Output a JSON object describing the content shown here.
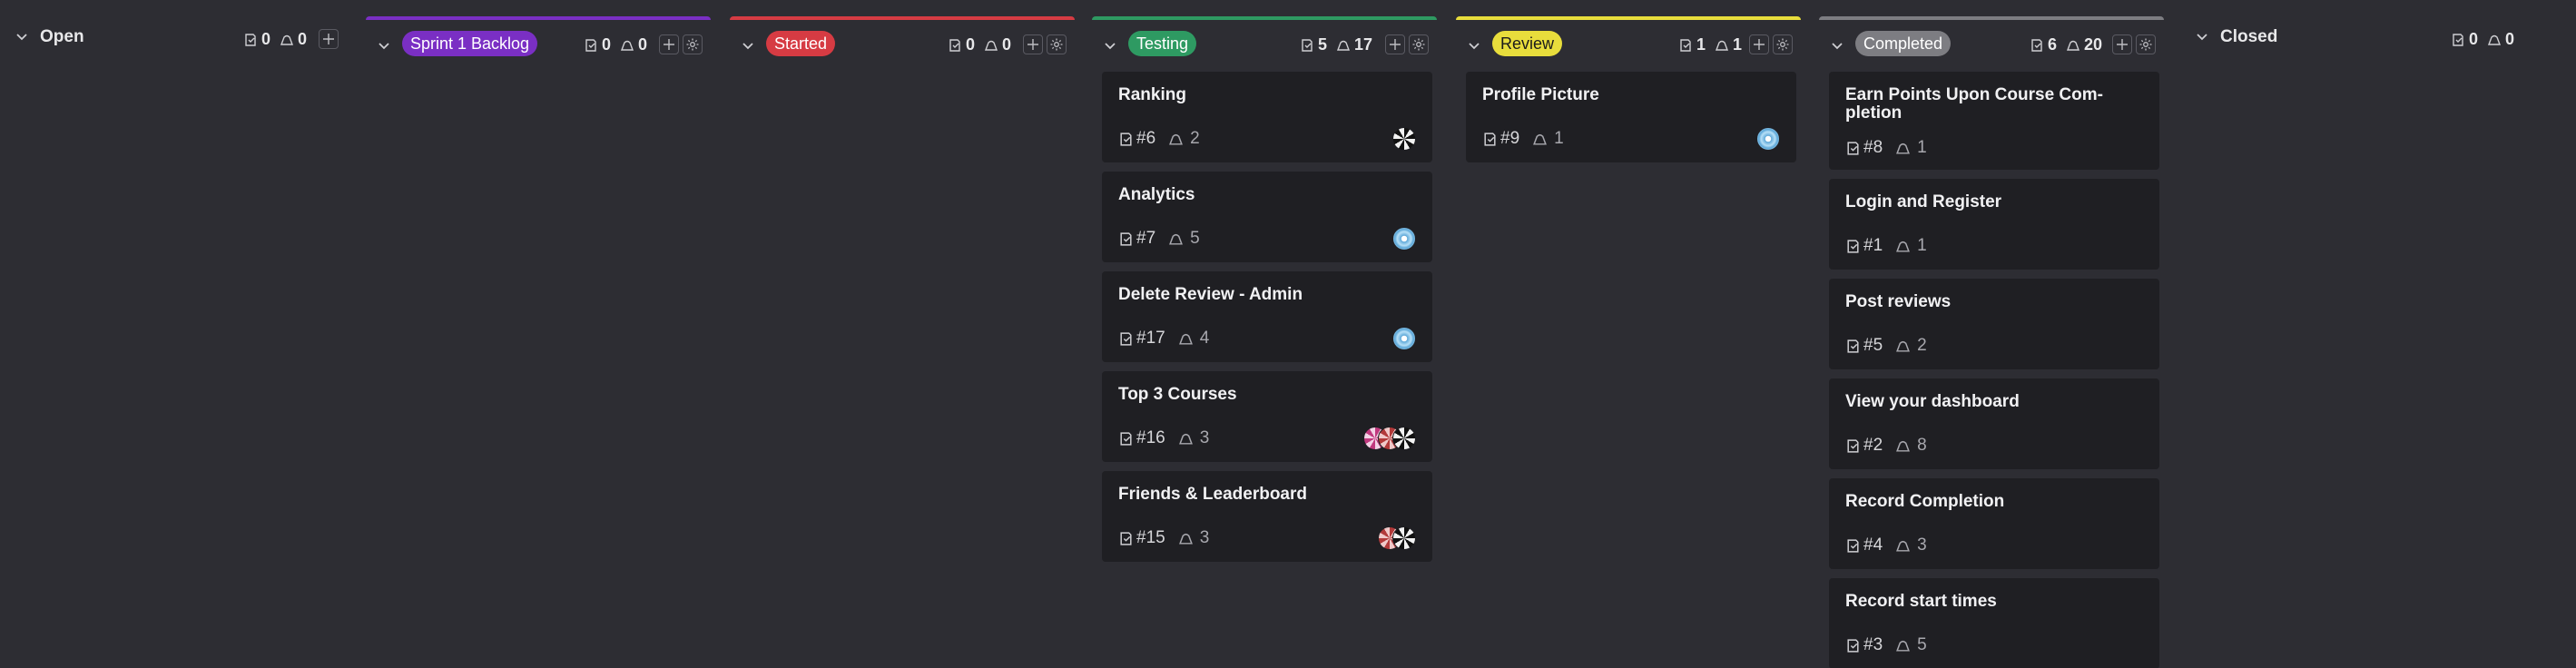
{
  "columns": [
    {
      "key": "open",
      "title": "Open",
      "styled": false,
      "task_count": "0",
      "points": "0",
      "has_actions": false
    },
    {
      "key": "sprint",
      "title": "Sprint 1 Backlog",
      "styled": true,
      "accent": "#7a2fc4",
      "pill_bg": "#7a2fc4",
      "pill_fg": "#ffffff",
      "task_count": "0",
      "points": "0",
      "has_actions": true
    },
    {
      "key": "started",
      "title": "Started",
      "styled": true,
      "accent": "#d63b43",
      "pill_bg": "#d63b43",
      "pill_fg": "#ffffff",
      "task_count": "0",
      "points": "0",
      "has_actions": true
    },
    {
      "key": "testing",
      "title": "Testing",
      "styled": true,
      "accent": "#2e9a62",
      "pill_bg": "#2e9a62",
      "pill_fg": "#ffffff",
      "task_count": "5",
      "points": "17",
      "has_actions": true
    },
    {
      "key": "review",
      "title": "Review",
      "styled": true,
      "accent": "#e8dd3c",
      "pill_bg": "#e8dd3c",
      "pill_fg": "#1b1b1b",
      "task_count": "1",
      "points": "1",
      "has_actions": true
    },
    {
      "key": "completed",
      "title": "Completed",
      "styled": true,
      "accent": "#7d7d82",
      "pill_bg": "#7d7d82",
      "pill_fg": "#ffffff",
      "task_count": "6",
      "points": "20",
      "has_actions": true
    },
    {
      "key": "closed",
      "title": "Closed",
      "styled": false,
      "task_count": "0",
      "points": "0",
      "has_actions": false
    }
  ],
  "cards": {
    "testing": [
      {
        "title": "Ranking",
        "id": "#6",
        "points": "2",
        "avatars": [
          "bw"
        ]
      },
      {
        "title": "Analytics",
        "id": "#7",
        "points": "5",
        "avatars": [
          "blue"
        ]
      },
      {
        "title": "Delete Review - Admin",
        "id": "#17",
        "points": "4",
        "avatars": [
          "blue"
        ]
      },
      {
        "title": "Top 3 Courses",
        "id": "#16",
        "points": "3",
        "avatars": [
          "bw",
          "red",
          "pink"
        ]
      },
      {
        "title": "Friends & Leaderboard",
        "id": "#15",
        "points": "3",
        "avatars": [
          "bw",
          "red"
        ]
      }
    ],
    "review": [
      {
        "title": "Profile Picture",
        "id": "#9",
        "points": "1",
        "avatars": [
          "blue"
        ]
      }
    ],
    "completed": [
      {
        "title": "Earn Points Upon Course Com-pletion",
        "id": "#8",
        "points": "1",
        "avatars": []
      },
      {
        "title": "Login and Register",
        "id": "#1",
        "points": "1",
        "avatars": []
      },
      {
        "title": "Post reviews",
        "id": "#5",
        "points": "2",
        "avatars": []
      },
      {
        "title": "View your dashboard",
        "id": "#2",
        "points": "8",
        "avatars": []
      },
      {
        "title": "Record Completion",
        "id": "#4",
        "points": "3",
        "avatars": []
      },
      {
        "title": "Record start times",
        "id": "#3",
        "points": "5",
        "avatars": []
      }
    ]
  },
  "icons": {
    "collapse": "chevron-down-icon",
    "tasks": "task-icon",
    "points": "points-icon",
    "add": "plus-icon",
    "settings": "gear-icon"
  }
}
